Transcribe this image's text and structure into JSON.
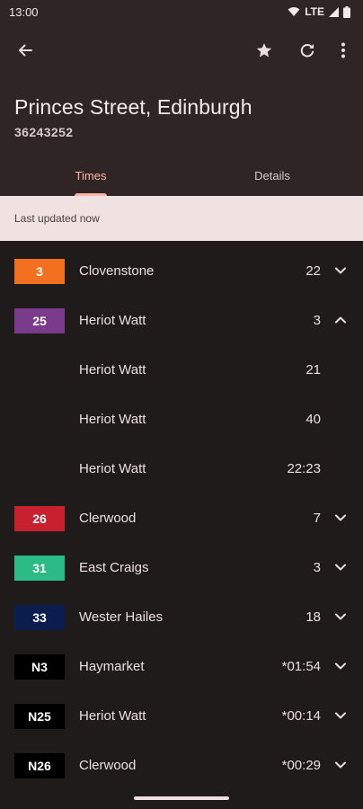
{
  "status_bar": {
    "time": "13:00",
    "network": "LTE"
  },
  "header": {
    "title": "Princes Street, Edinburgh",
    "stop_code": "36243252",
    "tabs": [
      {
        "label": "Times",
        "selected": true
      },
      {
        "label": "Details",
        "selected": false
      }
    ]
  },
  "banner": {
    "text": "Last updated now"
  },
  "departures": [
    {
      "route": "3",
      "color": "#f37021",
      "text_color": "#ffffff",
      "destination": "Clovenstone",
      "time": "22",
      "chevron": "down"
    },
    {
      "route": "25",
      "color": "#7b3b8c",
      "text_color": "#ffffff",
      "destination": "Heriot Watt",
      "time": "3",
      "chevron": "up"
    },
    {
      "route": "",
      "color": "",
      "destination": "Heriot Watt",
      "time": "21",
      "chevron": ""
    },
    {
      "route": "",
      "color": "",
      "destination": "Heriot Watt",
      "time": "40",
      "chevron": ""
    },
    {
      "route": "",
      "color": "",
      "destination": "Heriot Watt",
      "time": "22:23",
      "chevron": ""
    },
    {
      "route": "26",
      "color": "#c8202e",
      "text_color": "#ffffff",
      "destination": "Clerwood",
      "time": "7",
      "chevron": "down"
    },
    {
      "route": "31",
      "color": "#2dbb85",
      "text_color": "#ffffff",
      "destination": "East Craigs",
      "time": "3",
      "chevron": "down"
    },
    {
      "route": "33",
      "color": "#0b1d4f",
      "text_color": "#ffffff",
      "destination": "Wester Hailes",
      "time": "18",
      "chevron": "down"
    },
    {
      "route": "N3",
      "color": "#000000",
      "text_color": "#ffffff",
      "destination": "Haymarket",
      "time": "*01:54",
      "chevron": "down"
    },
    {
      "route": "N25",
      "color": "#000000",
      "text_color": "#ffffff",
      "destination": "Heriot Watt",
      "time": "*00:14",
      "chevron": "down"
    },
    {
      "route": "N26",
      "color": "#000000",
      "text_color": "#ffffff",
      "destination": "Clerwood",
      "time": "*00:29",
      "chevron": "down"
    }
  ],
  "icons": {
    "back": "arrow-left-icon",
    "favourite": "star-icon",
    "refresh": "refresh-icon",
    "overflow": "more-vert-icon"
  },
  "colors": {
    "accent": "#ffb4a8",
    "surface": "#2f2524",
    "background": "#1f1b1b",
    "banner": "#f0e2e0"
  }
}
